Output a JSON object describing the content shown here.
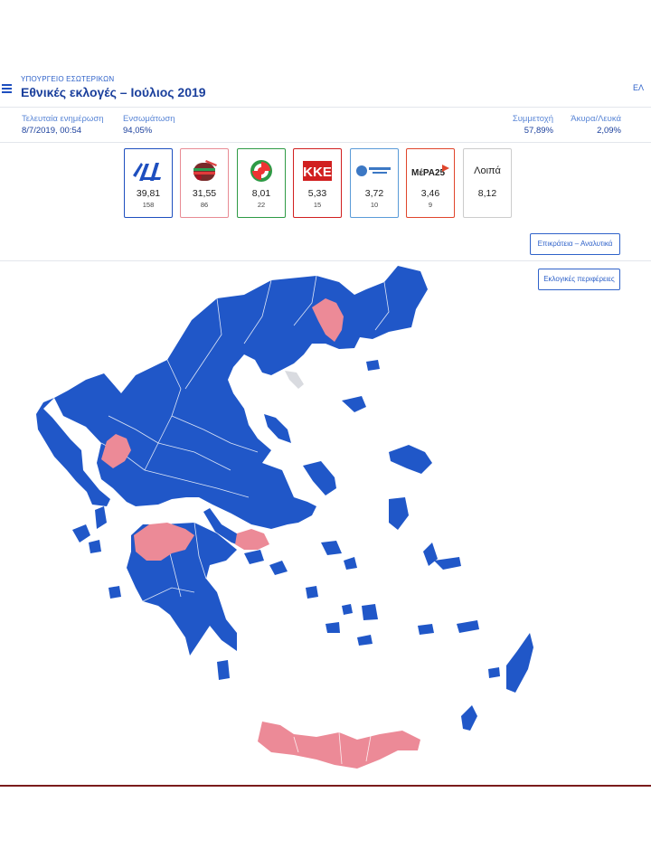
{
  "header": {
    "ministry": "ΥΠΟΥΡΓΕΙΟ ΕΣΩΤΕΡΙΚΩΝ",
    "title": "Εθνικές εκλογές – Ιούλιος 2019",
    "language": "ΕΛ"
  },
  "stats": {
    "last_update_label": "Τελευταία ενημέρωση",
    "last_update_value": "8/7/2019, 00:54",
    "incorporation_label": "Ενσωμάτωση",
    "incorporation_value": "94,05%",
    "turnout_label": "Συμμετοχή",
    "turnout_value": "57,89%",
    "invalid_label": "Άκυρα/Λευκά",
    "invalid_value": "2,09%"
  },
  "parties": [
    {
      "logo": "Νέα Δημοκρατία logo",
      "percent": "39,81",
      "seats": "158",
      "color": "#1e4fbf"
    },
    {
      "logo": "ΣΥΡΙΖΑ logo",
      "percent": "31,55",
      "seats": "86",
      "color": "#e88b94"
    },
    {
      "logo": "ΚΙΝΑΛ logo",
      "percent": "8,01",
      "seats": "22",
      "color": "#2e9a45"
    },
    {
      "logo": "ΚΚΕ",
      "percent": "5,33",
      "seats": "15",
      "color": "#d11f1f"
    },
    {
      "logo": "ΕΛΛΗΝΙΚΗ ΛΥΣΗ logo",
      "percent": "3,72",
      "seats": "10",
      "color": "#5a9bd8"
    },
    {
      "logo": "ΜέΡΑ25",
      "percent": "3,46",
      "seats": "9",
      "color": "#e0452b"
    },
    {
      "logo": "Λοιπά",
      "percent": "8,12",
      "seats": "",
      "color": "#cccccc"
    }
  ],
  "buttons": {
    "state_label": "Επικράτεια – Αναλυτικά",
    "regions_label": "Εκλογικές περιφέρειες"
  },
  "map": {
    "nd_color": "#2057c8",
    "syriza_color": "#ec8a97",
    "undecided_color": "#d9dbe0"
  }
}
